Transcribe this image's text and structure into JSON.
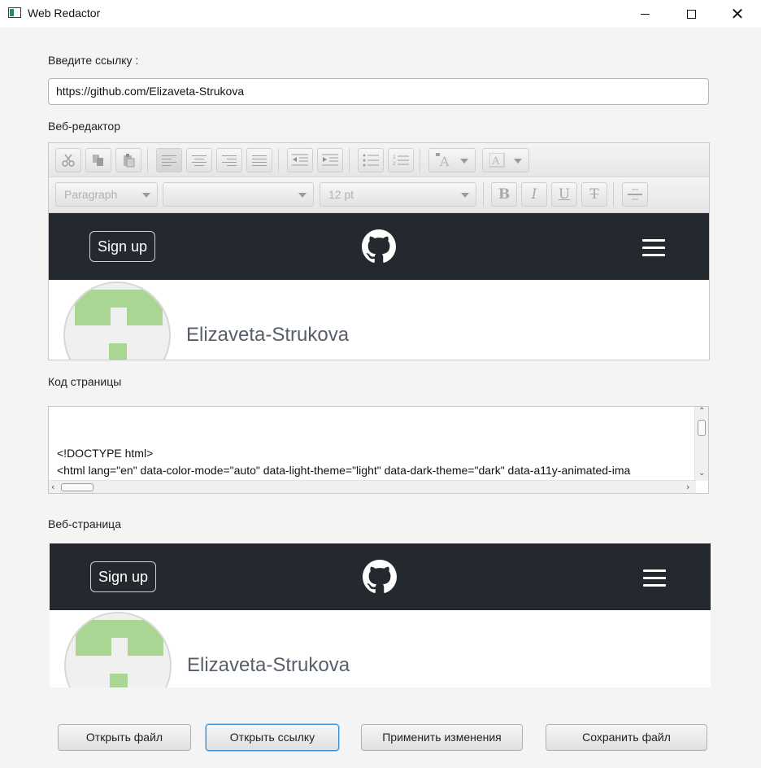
{
  "window": {
    "title": "Web Redactor"
  },
  "url_section": {
    "label": "Введите ссылку :",
    "value": "https://github.com/Elizaveta-Strukova"
  },
  "editor_section": {
    "label": "Веб-редактор",
    "format_value": "Paragraph",
    "font_value": "",
    "size_value": "12 pt",
    "bold_label": "B",
    "italic_label": "I",
    "underline_label": "U",
    "strike_label": "T"
  },
  "preview": {
    "signup_label": "Sign up",
    "username": "Elizaveta-Strukova"
  },
  "code_section": {
    "label": "Код страницы",
    "lines": [
      "<!DOCTYPE html>",
      "<html lang=\"en\" data-color-mode=\"auto\" data-light-theme=\"light\" data-dark-theme=\"dark\" data-a11y-animated-ima"
    ]
  },
  "webpage_section": {
    "label": "Веб-страница",
    "signup_label": "Sign up",
    "username": "Elizaveta-Strukova"
  },
  "buttons": {
    "open_file": "Открыть файл",
    "open_link": "Открыть ссылку",
    "apply_changes": "Применить изменения",
    "save_file": "Сохранить файл"
  },
  "colors": {
    "gh_header": "#24292f",
    "avatar_block": "#a9d692",
    "focus_border": "#3a8fd6"
  }
}
